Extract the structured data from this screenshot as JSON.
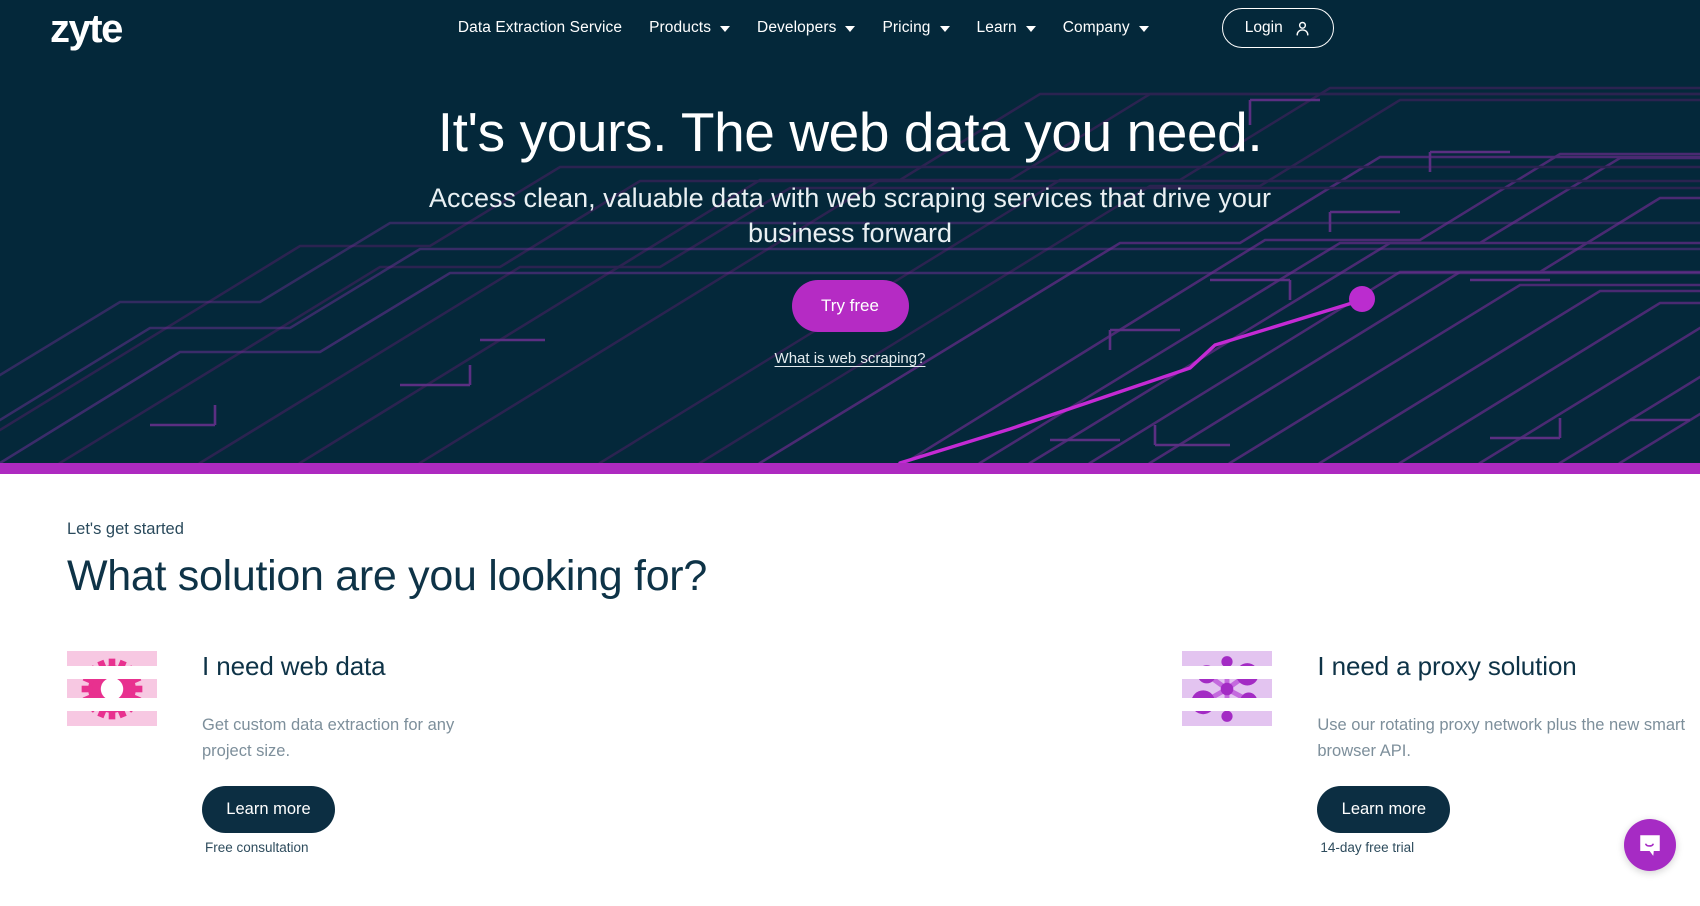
{
  "brand": {
    "logo_text": "zyte",
    "accent_purple": "#b52bc4",
    "dark_navy": "#04283a",
    "rule_purple": "#ad2ac0"
  },
  "nav": {
    "items": [
      {
        "label": "Data Extraction Service",
        "has_caret": false
      },
      {
        "label": "Products",
        "has_caret": true
      },
      {
        "label": "Developers",
        "has_caret": true
      },
      {
        "label": "Pricing",
        "has_caret": true
      },
      {
        "label": "Learn",
        "has_caret": true
      },
      {
        "label": "Company",
        "has_caret": true
      }
    ],
    "login_label": "Login",
    "login_icon": "user-icon"
  },
  "hero": {
    "title": "It's yours. The web data you need.",
    "subtitle": "Access clean, valuable data with web scraping services that drive your business forward",
    "cta_label": "Try free",
    "link_label": "What is web scraping?"
  },
  "solutions": {
    "eyebrow": "Let's get started",
    "heading": "What solution are you looking for?",
    "cards": [
      {
        "icon": "gear-icon",
        "title": "I need web data",
        "description": "Get custom data extraction for any project size.",
        "button_label": "Learn more",
        "caption": "Free consultation",
        "icon_bg": "#f7c8e2",
        "icon_color": "#e8318f"
      },
      {
        "icon": "network-nodes-icon",
        "title": "I need a proxy solution",
        "description": "Use our rotating proxy network plus the new smart browser API.",
        "button_label": "Learn more",
        "caption": "14-day free trial",
        "icon_bg": "#e3c4f0",
        "icon_color": "#a32bc4"
      }
    ]
  },
  "chat": {
    "icon": "chat-bubble-icon",
    "color": "#a62bc4"
  }
}
